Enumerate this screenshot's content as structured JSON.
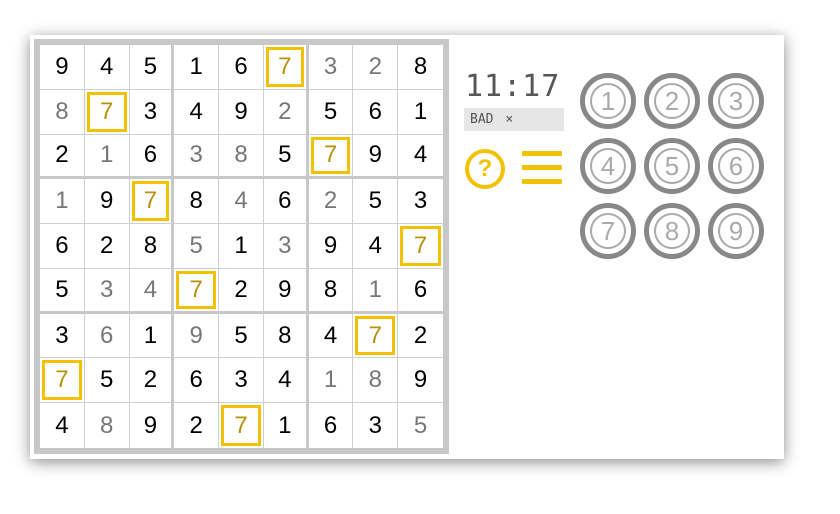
{
  "board": {
    "cells": [
      [
        "9",
        "4",
        "5",
        "1",
        "6",
        "7",
        "3",
        "2",
        "8"
      ],
      [
        "8",
        "7",
        "3",
        "4",
        "9",
        "2",
        "5",
        "6",
        "1"
      ],
      [
        "2",
        "1",
        "6",
        "3",
        "8",
        "5",
        "7",
        "9",
        "4"
      ],
      [
        "1",
        "9",
        "7",
        "8",
        "4",
        "6",
        "2",
        "5",
        "3"
      ],
      [
        "6",
        "2",
        "8",
        "5",
        "1",
        "3",
        "9",
        "4",
        "7"
      ],
      [
        "5",
        "3",
        "4",
        "7",
        "2",
        "9",
        "8",
        "1",
        "6"
      ],
      [
        "3",
        "6",
        "1",
        "9",
        "5",
        "8",
        "4",
        "7",
        "2"
      ],
      [
        "7",
        "5",
        "2",
        "6",
        "3",
        "4",
        "1",
        "8",
        "9"
      ],
      [
        "4",
        "8",
        "9",
        "2",
        "7",
        "1",
        "6",
        "3",
        "5"
      ]
    ],
    "user_entered": [
      [
        false,
        false,
        false,
        false,
        false,
        true,
        true,
        true,
        false
      ],
      [
        true,
        true,
        false,
        false,
        false,
        true,
        false,
        false,
        false
      ],
      [
        false,
        true,
        false,
        true,
        true,
        false,
        true,
        false,
        false
      ],
      [
        true,
        false,
        true,
        false,
        true,
        false,
        true,
        false,
        false
      ],
      [
        false,
        false,
        false,
        true,
        false,
        true,
        false,
        false,
        true
      ],
      [
        false,
        true,
        true,
        true,
        false,
        false,
        false,
        true,
        false
      ],
      [
        false,
        true,
        false,
        true,
        false,
        false,
        false,
        true,
        false
      ],
      [
        true,
        false,
        false,
        false,
        false,
        false,
        true,
        true,
        false
      ],
      [
        false,
        true,
        false,
        false,
        true,
        false,
        false,
        false,
        true
      ]
    ],
    "highlight_digit": "7",
    "highlight_color": "#f2c200"
  },
  "status": {
    "timer": "11:17",
    "badge_label": "BAD",
    "badge_close": "×"
  },
  "controls": {
    "help_label": "?",
    "help_icon": "question-circle-icon",
    "menu_icon": "hamburger-menu-icon",
    "accent_color": "#f2c200"
  },
  "numpad": {
    "digits": [
      "1",
      "2",
      "3",
      "4",
      "5",
      "6",
      "7",
      "8",
      "9"
    ]
  }
}
